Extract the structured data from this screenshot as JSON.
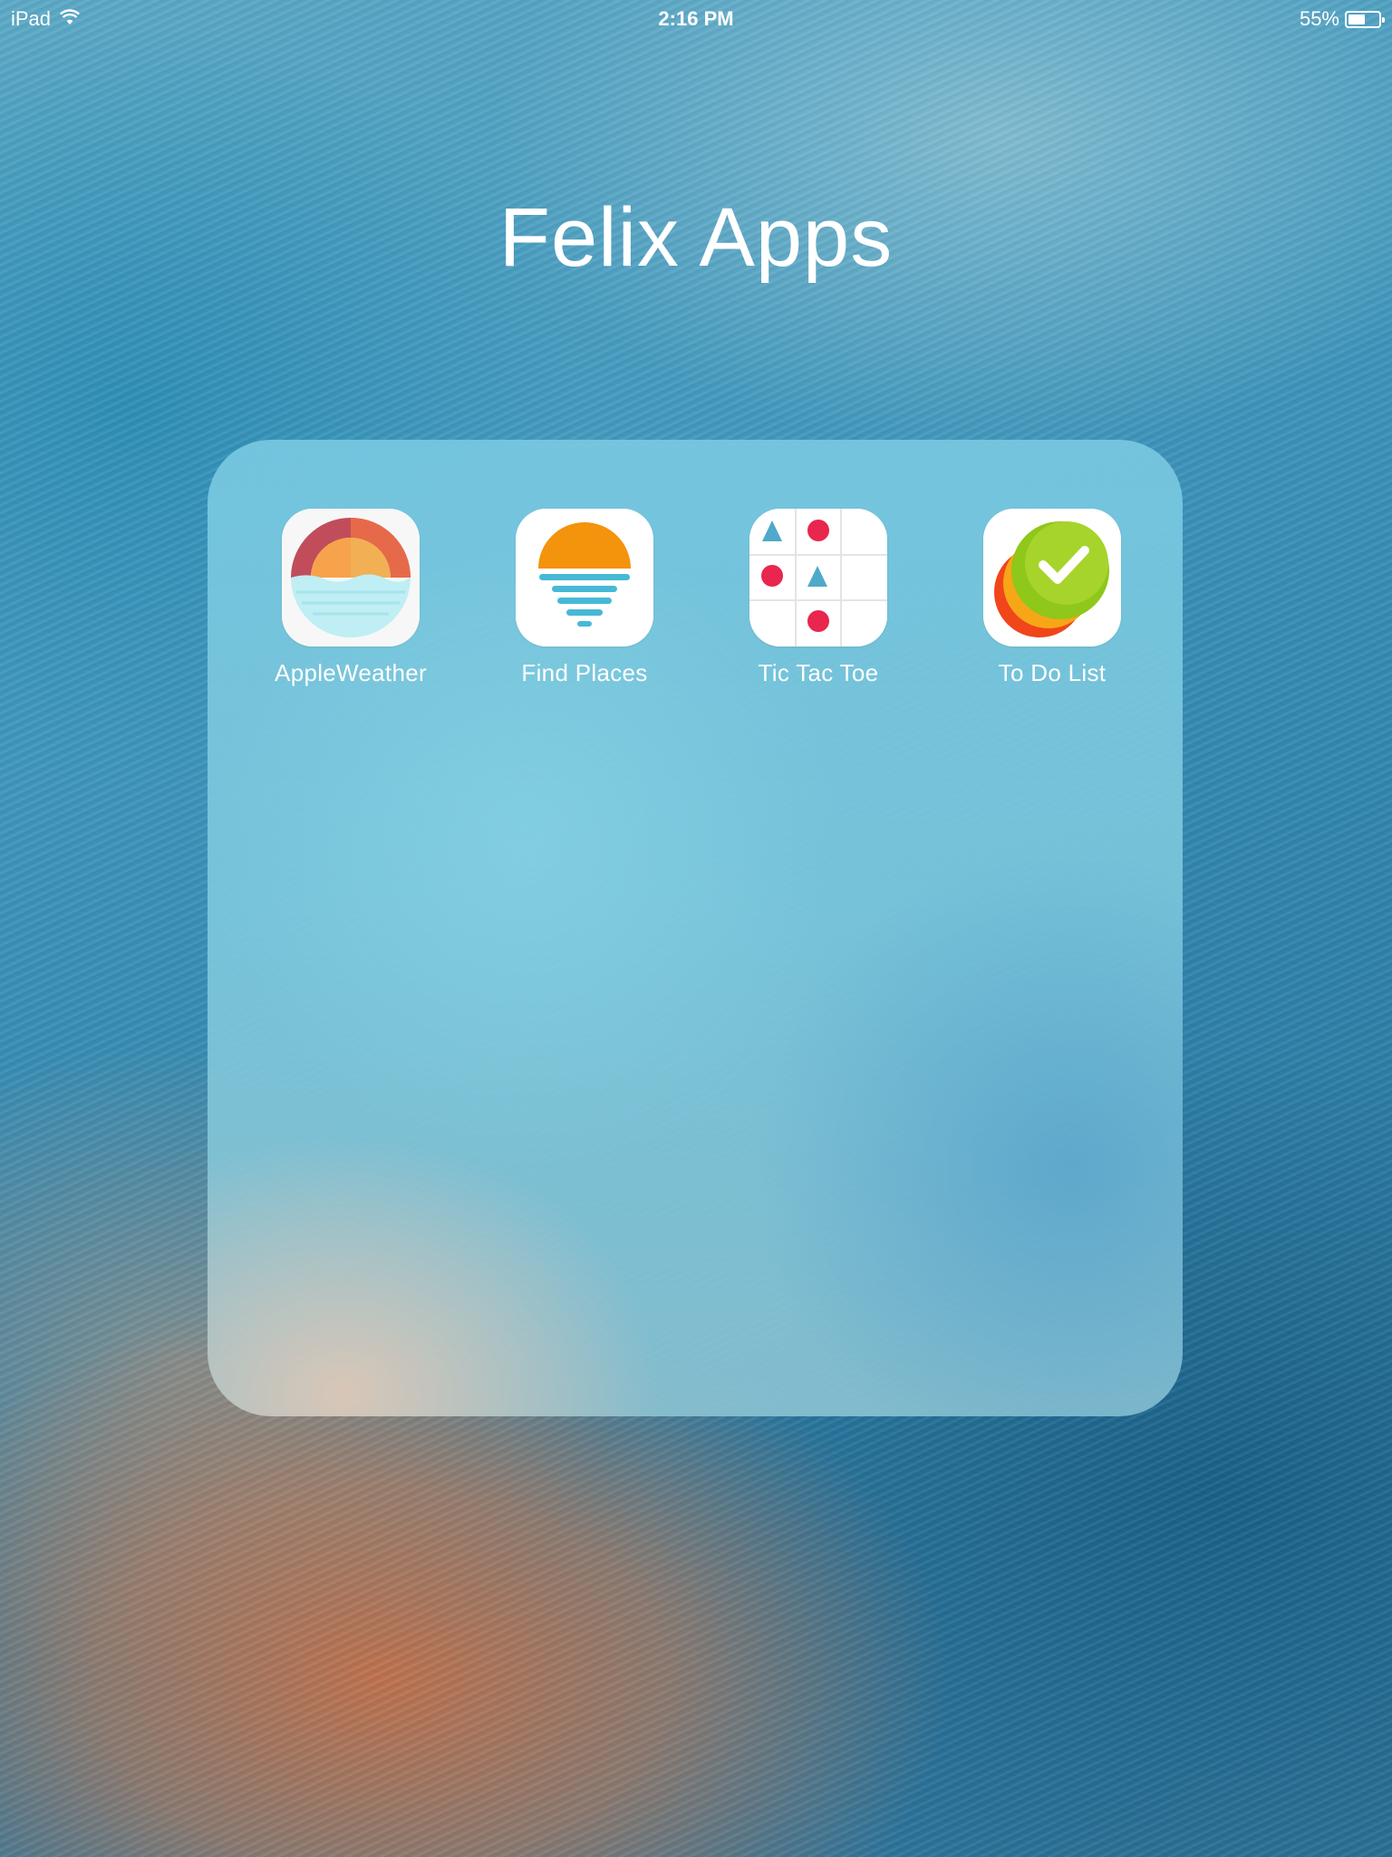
{
  "status_bar": {
    "device": "iPad",
    "time": "2:16 PM",
    "battery": "55%",
    "battery_level": 0.55
  },
  "folder": {
    "title": "Felix Apps",
    "apps": [
      {
        "label": "AppleWeather",
        "icon": "apple-weather-icon"
      },
      {
        "label": "Find Places",
        "icon": "find-places-icon"
      },
      {
        "label": "Tic Tac Toe",
        "icon": "tic-tac-toe-icon"
      },
      {
        "label": "To Do List",
        "icon": "to-do-list-icon"
      }
    ]
  },
  "colors": {
    "orange": "#f4930c",
    "teal": "#47b9d6",
    "red": "#e8264e",
    "green": "#8fc71a"
  }
}
